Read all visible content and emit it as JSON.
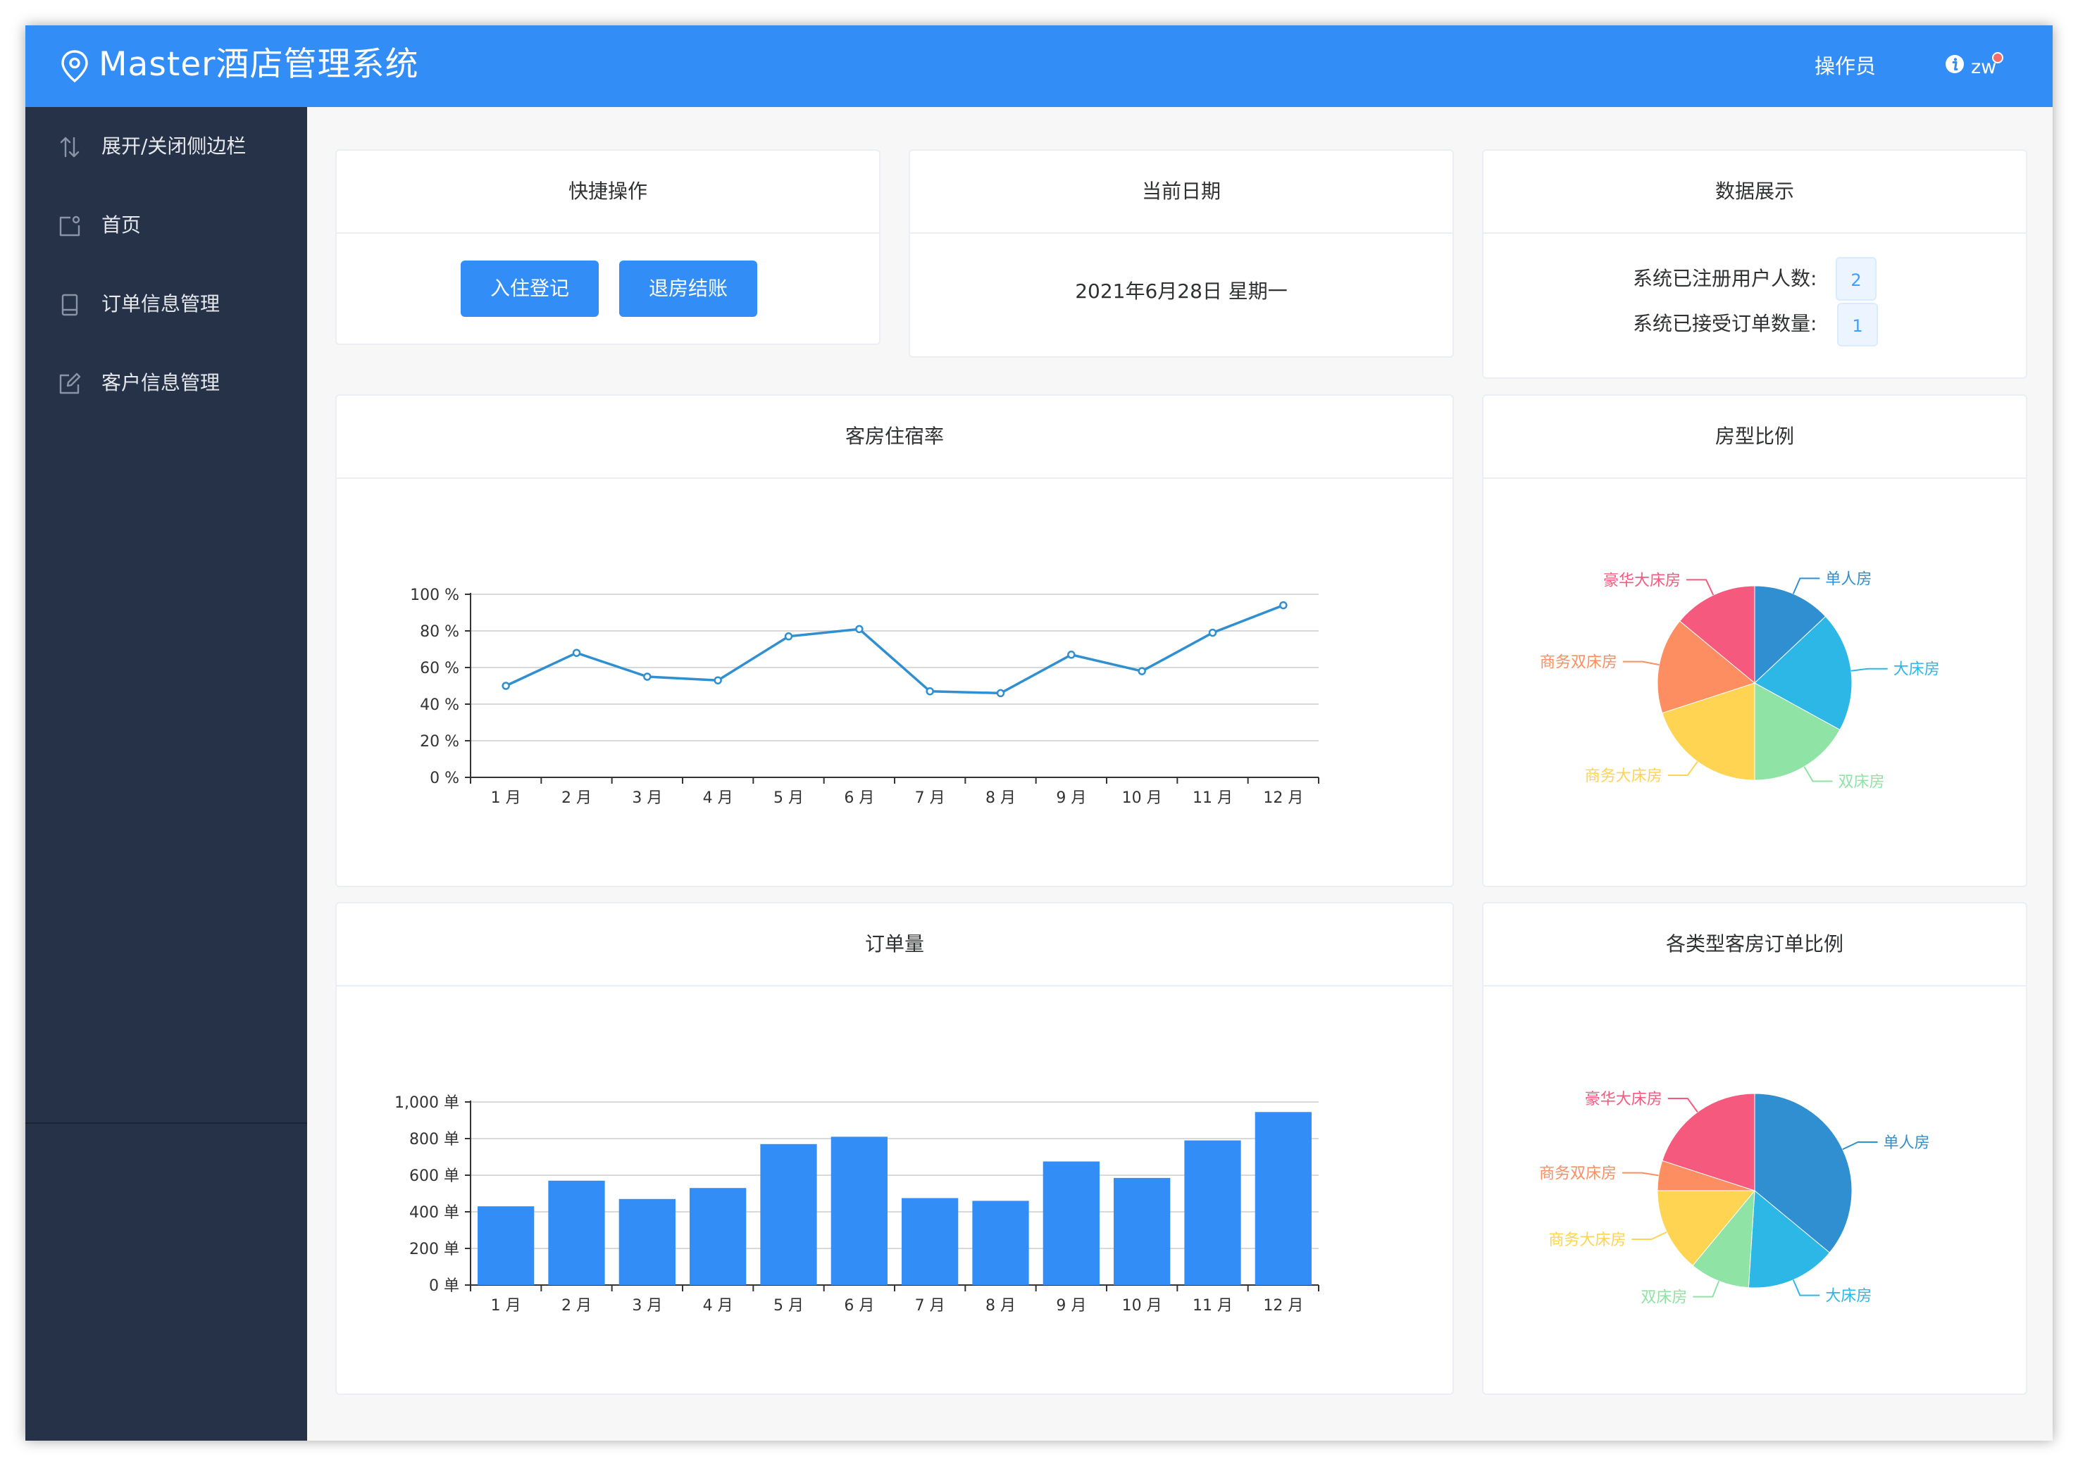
{
  "header": {
    "title": "Master酒店管理系统",
    "operator_link": "操作员",
    "user": "zw"
  },
  "sidebar": {
    "items": [
      {
        "label": "展开/关闭侧边栏"
      },
      {
        "label": "首页"
      },
      {
        "label": "订单信息管理"
      },
      {
        "label": "客户信息管理"
      }
    ]
  },
  "quick_actions": {
    "title": "快捷操作",
    "checkin_label": "入住登记",
    "checkout_label": "退房结账"
  },
  "current_date": {
    "title": "当前日期",
    "value": "2021年6月28日 星期一"
  },
  "stats": {
    "title": "数据展示",
    "users_label": "系统已注册用户人数:",
    "users_value": "2",
    "orders_label": "系统已接受订单数量:",
    "orders_value": "1"
  },
  "colors": {
    "brand": "#338df7",
    "sidebar_bg": "#253248",
    "line": "#2f8fd0",
    "bar": "#338df7",
    "pie": [
      "#2f8fd0",
      "#2db7e6",
      "#8ee3a5",
      "#fed452",
      "#fd8e62",
      "#f6597e"
    ]
  },
  "chart_data": [
    {
      "type": "line",
      "title": "客房住宿率",
      "categories": [
        "1 月",
        "2 月",
        "3 月",
        "4 月",
        "5 月",
        "6 月",
        "7 月",
        "8 月",
        "9 月",
        "10 月",
        "11 月",
        "12 月"
      ],
      "values": [
        50,
        68,
        55,
        53,
        77,
        81,
        47,
        46,
        67,
        58,
        79,
        94
      ],
      "yticks": [
        "0 %",
        "20 %",
        "40 %",
        "60 %",
        "80 %",
        "100 %"
      ],
      "ylim": [
        0,
        100
      ],
      "grid": true
    },
    {
      "type": "pie",
      "title": "房型比例",
      "series": [
        {
          "name": "单人房",
          "value": 13
        },
        {
          "name": "大床房",
          "value": 20
        },
        {
          "name": "双床房",
          "value": 17
        },
        {
          "name": "商务大床房",
          "value": 20
        },
        {
          "name": "商务双床房",
          "value": 16
        },
        {
          "name": "豪华大床房",
          "value": 14
        }
      ]
    },
    {
      "type": "bar",
      "title": "订单量",
      "categories": [
        "1 月",
        "2 月",
        "3 月",
        "4 月",
        "5 月",
        "6 月",
        "7 月",
        "8 月",
        "9 月",
        "10 月",
        "11 月",
        "12 月"
      ],
      "values": [
        430,
        570,
        470,
        530,
        770,
        810,
        475,
        460,
        675,
        585,
        790,
        945
      ],
      "yticks": [
        "0 单",
        "200 单",
        "400 单",
        "600 单",
        "800 单",
        "1,000 单"
      ],
      "ylim": [
        0,
        1000
      ],
      "grid": true
    },
    {
      "type": "pie",
      "title": "各类型客房订单比例",
      "series": [
        {
          "name": "单人房",
          "value": 36
        },
        {
          "name": "大床房",
          "value": 15
        },
        {
          "name": "双床房",
          "value": 10
        },
        {
          "name": "商务大床房",
          "value": 14
        },
        {
          "name": "商务双床房",
          "value": 5
        },
        {
          "name": "豪华大床房",
          "value": 20
        }
      ]
    }
  ]
}
